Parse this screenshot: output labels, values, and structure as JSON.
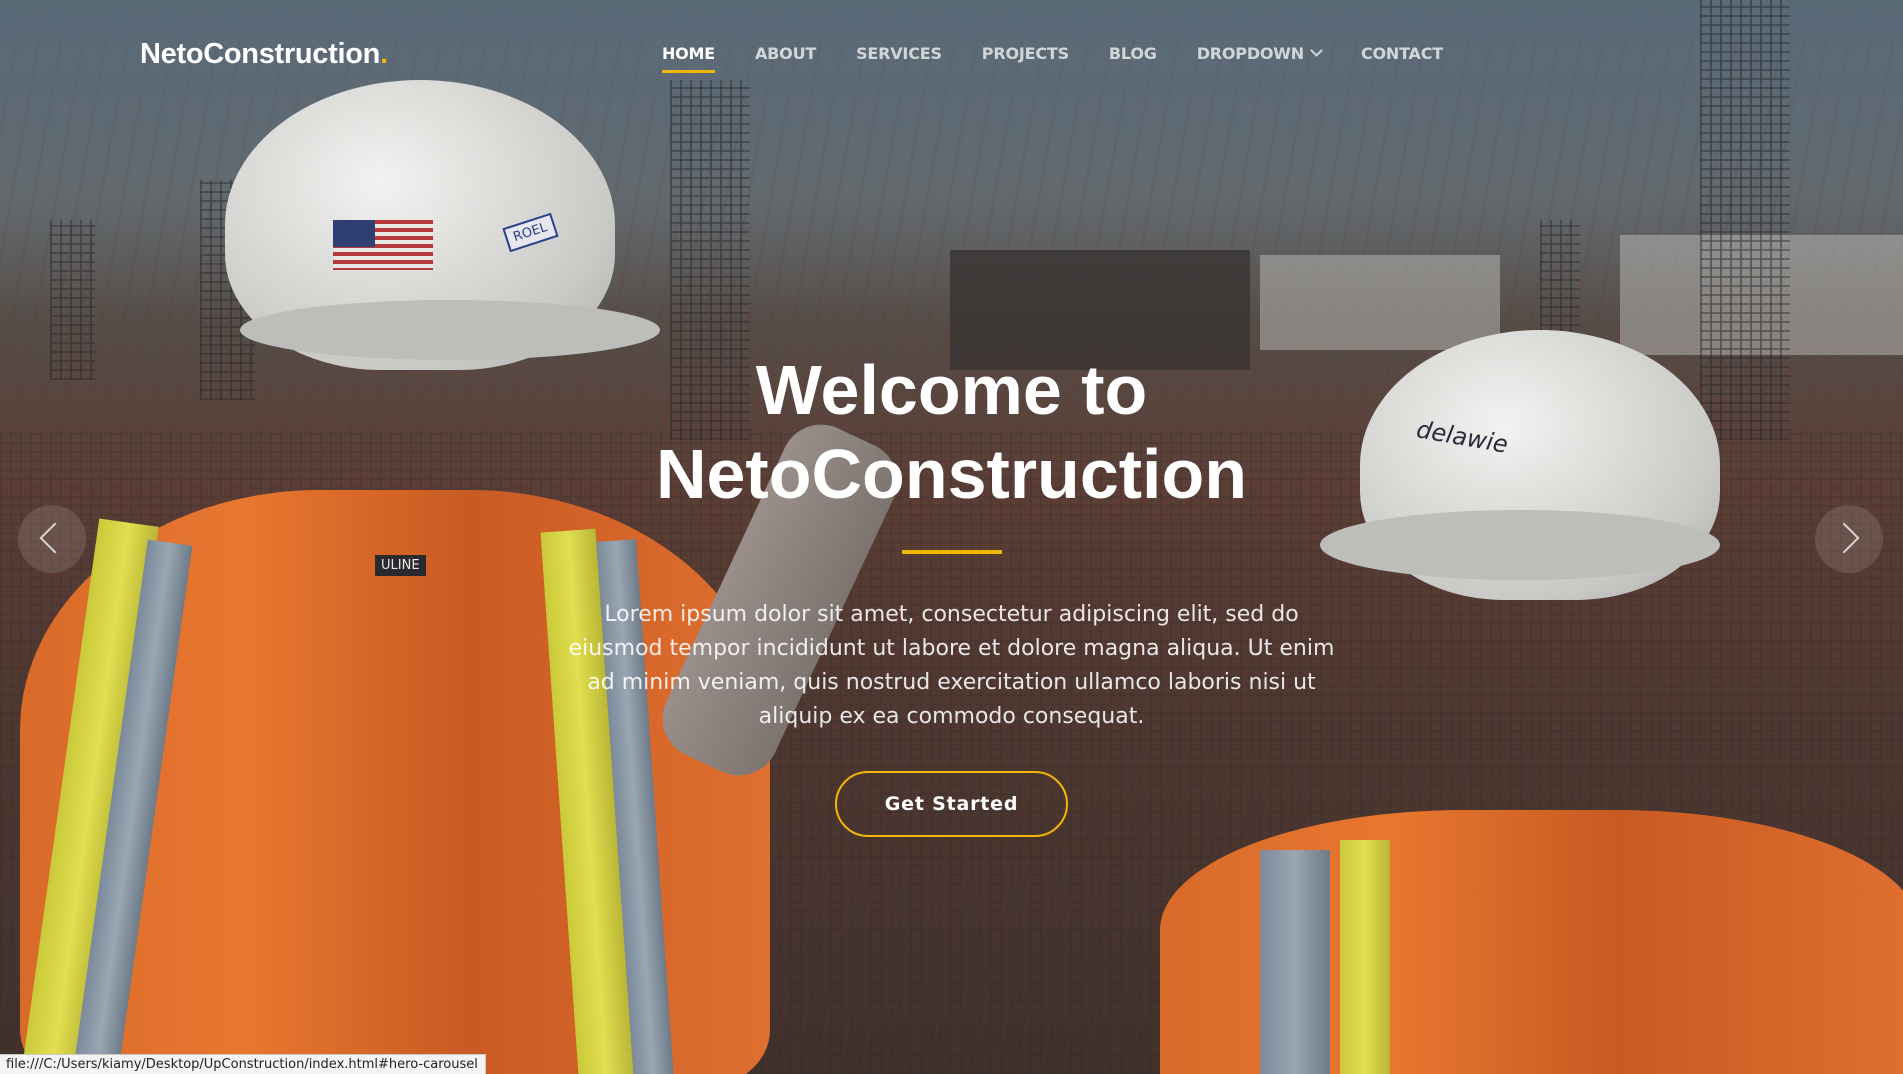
{
  "brand": {
    "name": "NetoConstruction",
    "suffix": ".",
    "accent_color": "#f2b705"
  },
  "nav": {
    "items": [
      {
        "label": "HOME",
        "active": true
      },
      {
        "label": "ABOUT",
        "active": false
      },
      {
        "label": "SERVICES",
        "active": false
      },
      {
        "label": "PROJECTS",
        "active": false
      },
      {
        "label": "BLOG",
        "active": false
      },
      {
        "label": "DROPDOWN",
        "active": false,
        "icon": "chevron-down-icon"
      },
      {
        "label": "CONTACT",
        "active": false
      }
    ]
  },
  "hero": {
    "title_line1": "Welcome to",
    "title_line2": "NetoConstruction",
    "text": "Lorem ipsum dolor sit amet, consectetur adipiscing elit, sed do eiusmod tempor incididunt ut labore et dolore magna aliqua. Ut enim ad minim veniam, quis nostrud exercitation ullamco laboris nisi ut aliquip ex ea commodo consequat.",
    "cta_label": "Get Started",
    "prev_icon": "chevron-left-icon",
    "next_icon": "chevron-right-icon",
    "image_labels": {
      "vest_patch": "ULINE",
      "helmet_left_sticker": "ROEL",
      "helmet_right_sticker": "delawie"
    }
  },
  "status_bar": {
    "url": "file:///C:/Users/kiamy/Desktop/UpConstruction/index.html#hero-carousel"
  }
}
